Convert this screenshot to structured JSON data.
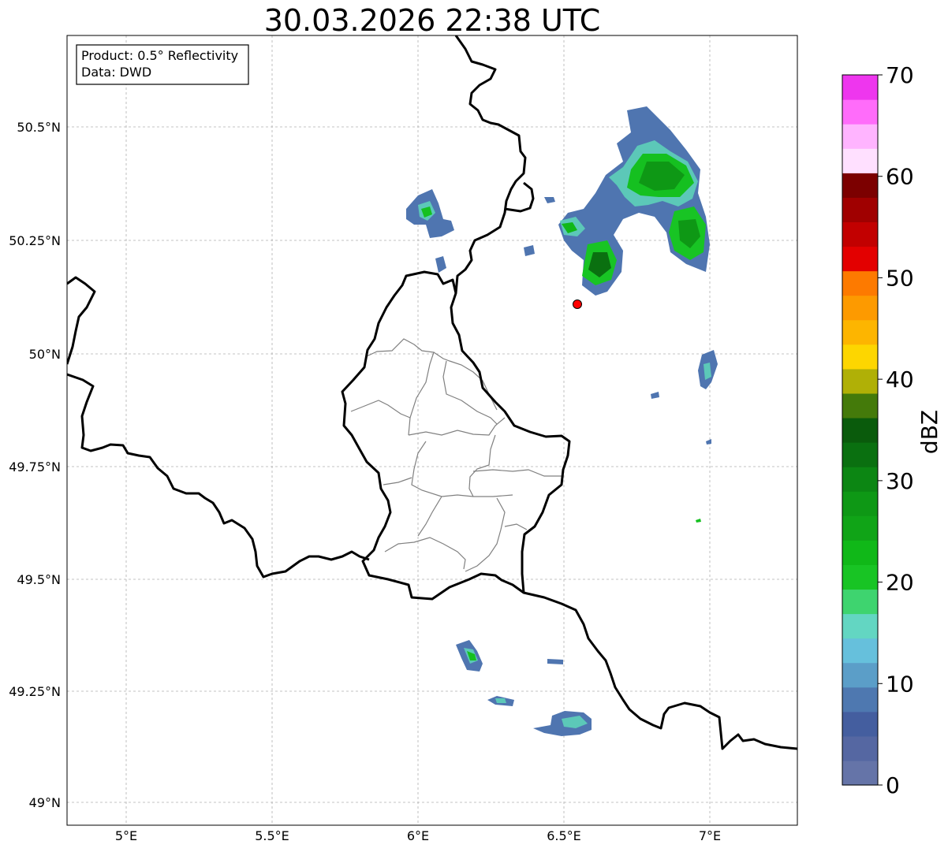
{
  "title": "30.03.2026 22:38 UTC",
  "info": {
    "product": "Product: 0.5° Reflectivity",
    "source": "Data: DWD"
  },
  "lon_labels": [
    "5°E",
    "5.5°E",
    "6°E",
    "6.5°E",
    "7°E"
  ],
  "lat_labels": [
    "50.5°N",
    "50.25°N",
    "50°N",
    "49.75°N",
    "49.5°N",
    "49.25°N",
    "49°N"
  ],
  "colorbar": {
    "label": "dBZ",
    "min": 0,
    "max": 70,
    "ticks": [
      "0",
      "10",
      "20",
      "30",
      "40",
      "50",
      "60",
      "70"
    ],
    "colors": [
      "#6574a8",
      "#5567a2",
      "#445e9f",
      "#4e78b0",
      "#5b9ec8",
      "#66c0dc",
      "#63d6c2",
      "#3ed46f",
      "#18c424",
      "#10b818",
      "#10a417",
      "#0e9815",
      "#0c8613",
      "#0a7010",
      "#0a5b0c",
      "#447a0a",
      "#b0b006",
      "#fdd600",
      "#fdb500",
      "#fd9a00",
      "#fd7a00",
      "#e30000",
      "#c20000",
      "#a00000",
      "#7c0000",
      "#ffe0ff",
      "#ffb4ff",
      "#ff6cfa",
      "#ee36ee"
    ]
  },
  "colors": {
    "border": "#000000",
    "districts": "#808080",
    "grid": "#b0b0b0",
    "radar_site": "#ff0000"
  },
  "radar_site_icon": "red-dot-marker"
}
